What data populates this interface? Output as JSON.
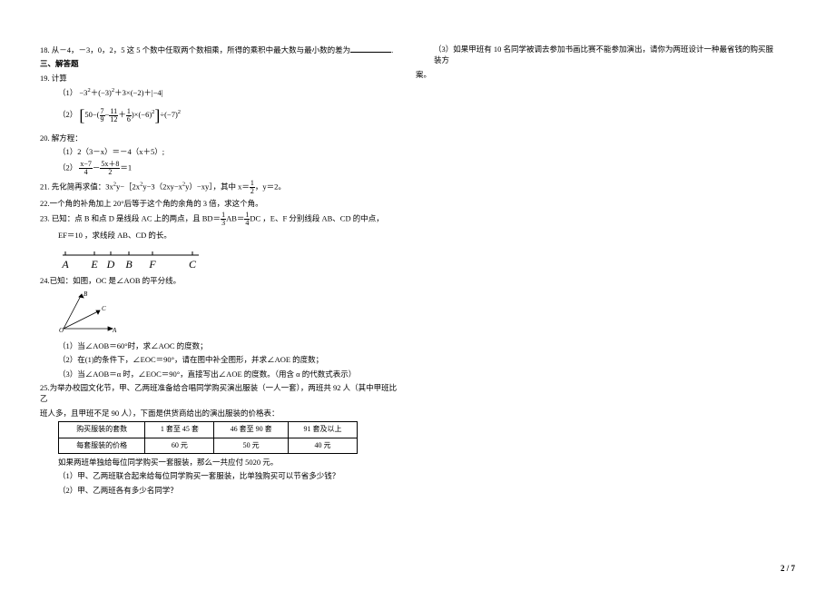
{
  "q18": {
    "num": "18.",
    "text": "从－4，－3，0，2，5 这 5 个数中任取两个数相乘，所得的乘积中最大数与最小数的差为",
    "period": "."
  },
  "sec3": "三、解答题",
  "q19": {
    "num": "19.",
    "title": "计算",
    "p1_label": "（1）",
    "p1": {
      "a": "−3",
      "ae": "2",
      "plus1": "＋(−3)",
      "ae2": "2",
      "plus2": "＋3×(−2)＋|−4|"
    },
    "p2_label": "（2）",
    "p2": {
      "open": "[",
      "fifty": "50−(",
      "f1n": "7",
      "f1d": "9",
      "minus1": "−",
      "f2n": "11",
      "f2d": "12",
      "plus1": "＋",
      "f3n": "1",
      "f3d": "6",
      "close_p": ")×(−6)",
      "he": "2",
      "close_b": "]",
      "div": "÷(−7)",
      "he2": "2"
    }
  },
  "q20": {
    "num": "20.",
    "title": "解方程：",
    "p1_label": "（1）",
    "p1": "2（3－x）＝－4（x＋5）;",
    "p2_label": "（2）",
    "p2": {
      "f1n": "x−7",
      "f1d": "4",
      "minus": "－",
      "f2n": "5x＋8",
      "f2d": "2",
      "eq": "＝1"
    }
  },
  "q21": {
    "num": "21.",
    "text_a": "先化简再求值：3x",
    "e1": "2",
    "text_b": "y−［2x",
    "e2": "2",
    "text_c": "y−3（2xy−x",
    "e3": "2",
    "text_d": "y）−xy］，其中 x＝",
    "xn": "1",
    "xd": "2",
    "text_e": "，y＝2。"
  },
  "q22": {
    "num": "22.",
    "text": "一个角的补角加上 20°后等于这个角的余角的 3 倍，求这个角。"
  },
  "q23": {
    "num": "23.",
    "text_a": "已知：点 B 和点 D 是线段 AC 上的两点，且 BD＝",
    "f1n": "1",
    "f1d": "3",
    "mid1": "AB＝",
    "f2n": "1",
    "f2d": "4",
    "mid2": "DC ，E、F 分别线段 AB、CD 的中点，",
    "line2": "EF＝10 ，求线段 AB、CD 的长。",
    "labels": [
      "A",
      "E",
      "D",
      "B",
      "F",
      "C"
    ]
  },
  "q24": {
    "num": "24.",
    "title": "已知：如图，OC 是∠AOB 的平分线。",
    "dl": {
      "B": "B",
      "C": "C",
      "O": "O",
      "A": "A"
    },
    "p1": "（1）当∠AOB＝60°时，求∠AOC 的度数；",
    "p2": "（2）在(1)的条件下，∠EOC＝90°，请在图中补全图形，并求∠AOE 的度数；",
    "p3": "（3）当∠AOB＝α 时，∠EOC＝90°，直接写出∠AOE 的度数。（用含 α 的代数式表示）"
  },
  "q25": {
    "num": "25.",
    "text1": "为举办校园文化节，甲、乙两班准备给合唱同学购买演出服装（一人一套），两班共 92 人（其中甲班比乙",
    "text2": "班人多，且甲班不足 90 人），下面是供货商给出的演出服装的价格表：",
    "table": {
      "r1": [
        "购买服装的套数",
        "1 套至 45 套",
        "46 套至 90 套",
        "91 套及以上"
      ],
      "r2": [
        "每套服装的价格",
        "60 元",
        "50 元",
        "40 元"
      ]
    },
    "text3": "如果两班单独给每位同学购买一套服装，那么一共应付 5020 元。",
    "p1": "（1）甲、乙两班联合起来给每位同学购买一套服装，比单独购买可以节省多少钱？",
    "p2": "（2）甲、乙两班各有多少名同学？"
  },
  "right": {
    "p3": "（3）如果甲班有 10 名同学被调去参加书画比赛不能参加演出，请你为两班设计一种最省钱的购买服装方",
    "p3b": "案。"
  },
  "footer": "2 / 7"
}
